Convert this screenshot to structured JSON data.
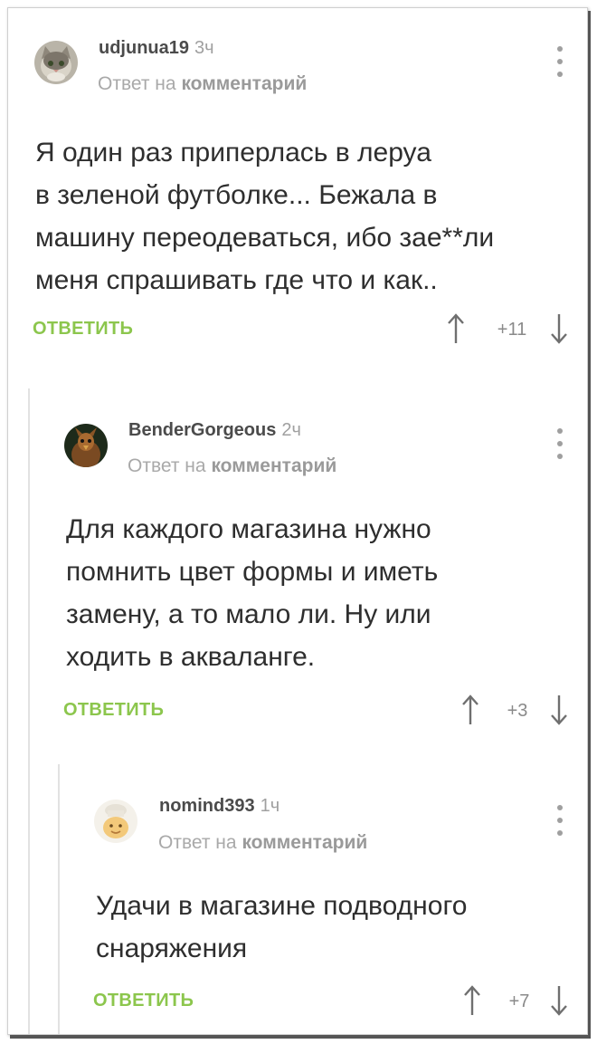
{
  "comments": [
    {
      "username": "udjunua19",
      "time": "3ч",
      "reply_prefix": "Ответ на",
      "reply_target": "комментарий",
      "text_lines": [
        "Я один раз приперлась в леруа",
        "в зеленой футболке... Бежала в",
        "машину переодеваться, ибо зае**ли",
        "меня спрашивать где что и как.."
      ],
      "reply_label": "ОТВЕТИТЬ",
      "rating": "+11",
      "avatar_icon": "cat-avatar-icon"
    },
    {
      "username": "BenderGorgeous",
      "time": "2ч",
      "reply_prefix": "Ответ на",
      "reply_target": "комментарий",
      "text_lines": [
        "Для каждого магазина нужно",
        "помнить цвет формы и иметь",
        "замену, а то мало ли. Ну или",
        "ходить в акваланге."
      ],
      "reply_label": "ОТВЕТИТЬ",
      "rating": "+3",
      "avatar_icon": "bird-avatar-icon"
    },
    {
      "username": "nomind393",
      "time": "1ч",
      "reply_prefix": "Ответ на",
      "reply_target": "комментарий",
      "text_lines": [
        "Удачи в магазине подводного",
        "снаряжения"
      ],
      "reply_label": "ОТВЕТИТЬ",
      "rating": "+7",
      "avatar_icon": "chef-avatar-icon"
    }
  ],
  "colors": {
    "accent_green": "#8cc64d",
    "text": "#2e2e2e",
    "muted": "#a9a9a9"
  }
}
